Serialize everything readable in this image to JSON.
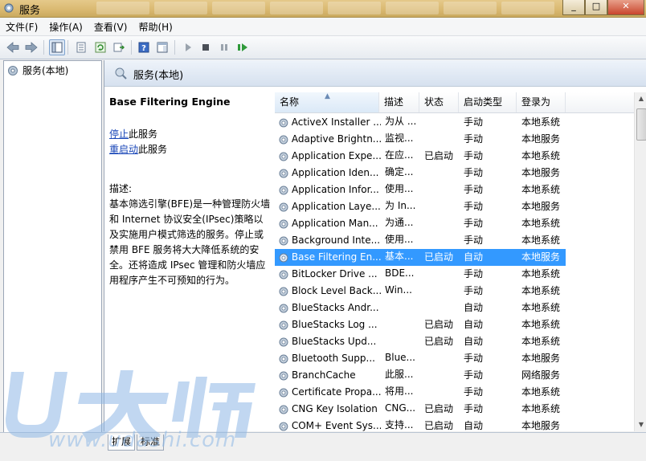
{
  "window": {
    "title": "服务",
    "buttons": [
      "_",
      "□",
      "✕"
    ]
  },
  "menu": [
    "文件(F)",
    "操作(A)",
    "查看(V)",
    "帮助(H)"
  ],
  "tree": {
    "root": "服务(本地)"
  },
  "header": {
    "title": "服务(本地)"
  },
  "detail": {
    "service_name": "Base Filtering Engine",
    "stop_link": "停止",
    "stop_suffix": "此服务",
    "restart_link": "重启动",
    "restart_suffix": "此服务",
    "desc_label": "描述:",
    "desc_text": "基本筛选引擎(BFE)是一种管理防火墙和 Internet 协议安全(IPsec)策略以及实施用户模式筛选的服务。停止或禁用 BFE 服务将大大降低系统的安全。还将造成 IPsec 管理和防火墙应用程序产生不可预知的行为。"
  },
  "columns": {
    "name": "名称",
    "description": "描述",
    "status": "状态",
    "startup": "启动类型",
    "logon": "登录为"
  },
  "rows": [
    {
      "name": "ActiveX Installer ...",
      "description": "为从 ...",
      "status": "",
      "startup": "手动",
      "logon": "本地系统"
    },
    {
      "name": "Adaptive Brightn...",
      "description": "监视...",
      "status": "",
      "startup": "手动",
      "logon": "本地服务"
    },
    {
      "name": "Application Expe...",
      "description": "在应...",
      "status": "已启动",
      "startup": "手动",
      "logon": "本地系统"
    },
    {
      "name": "Application Iden...",
      "description": "确定...",
      "status": "",
      "startup": "手动",
      "logon": "本地服务"
    },
    {
      "name": "Application Infor...",
      "description": "使用...",
      "status": "",
      "startup": "手动",
      "logon": "本地系统"
    },
    {
      "name": "Application Laye...",
      "description": "为 In...",
      "status": "",
      "startup": "手动",
      "logon": "本地服务"
    },
    {
      "name": "Application Man...",
      "description": "为通...",
      "status": "",
      "startup": "手动",
      "logon": "本地系统"
    },
    {
      "name": "Background Inte...",
      "description": "使用...",
      "status": "",
      "startup": "手动",
      "logon": "本地系统"
    },
    {
      "name": "Base Filtering En...",
      "description": "基本...",
      "status": "已启动",
      "startup": "自动",
      "logon": "本地服务",
      "selected": true
    },
    {
      "name": "BitLocker Drive ...",
      "description": "BDE...",
      "status": "",
      "startup": "手动",
      "logon": "本地系统"
    },
    {
      "name": "Block Level Back...",
      "description": "Win...",
      "status": "",
      "startup": "手动",
      "logon": "本地系统"
    },
    {
      "name": "BlueStacks Andr...",
      "description": "",
      "status": "",
      "startup": "自动",
      "logon": "本地系统"
    },
    {
      "name": "BlueStacks Log ...",
      "description": "",
      "status": "已启动",
      "startup": "自动",
      "logon": "本地系统"
    },
    {
      "name": "BlueStacks Upd...",
      "description": "",
      "status": "已启动",
      "startup": "自动",
      "logon": "本地系统"
    },
    {
      "name": "Bluetooth Supp...",
      "description": "Blue...",
      "status": "",
      "startup": "手动",
      "logon": "本地服务"
    },
    {
      "name": "BranchCache",
      "description": "此服...",
      "status": "",
      "startup": "手动",
      "logon": "网络服务"
    },
    {
      "name": "Certificate Propa...",
      "description": "将用...",
      "status": "",
      "startup": "手动",
      "logon": "本地系统"
    },
    {
      "name": "CNG Key Isolation",
      "description": "CNG...",
      "status": "已启动",
      "startup": "手动",
      "logon": "本地系统"
    },
    {
      "name": "COM+ Event Sys...",
      "description": "支持...",
      "status": "已启动",
      "startup": "自动",
      "logon": "本地服务"
    }
  ],
  "bottom_tabs": [
    "扩展",
    "标准"
  ],
  "watermark": {
    "logo_text": "U大师",
    "url": "www.udashi.com"
  }
}
